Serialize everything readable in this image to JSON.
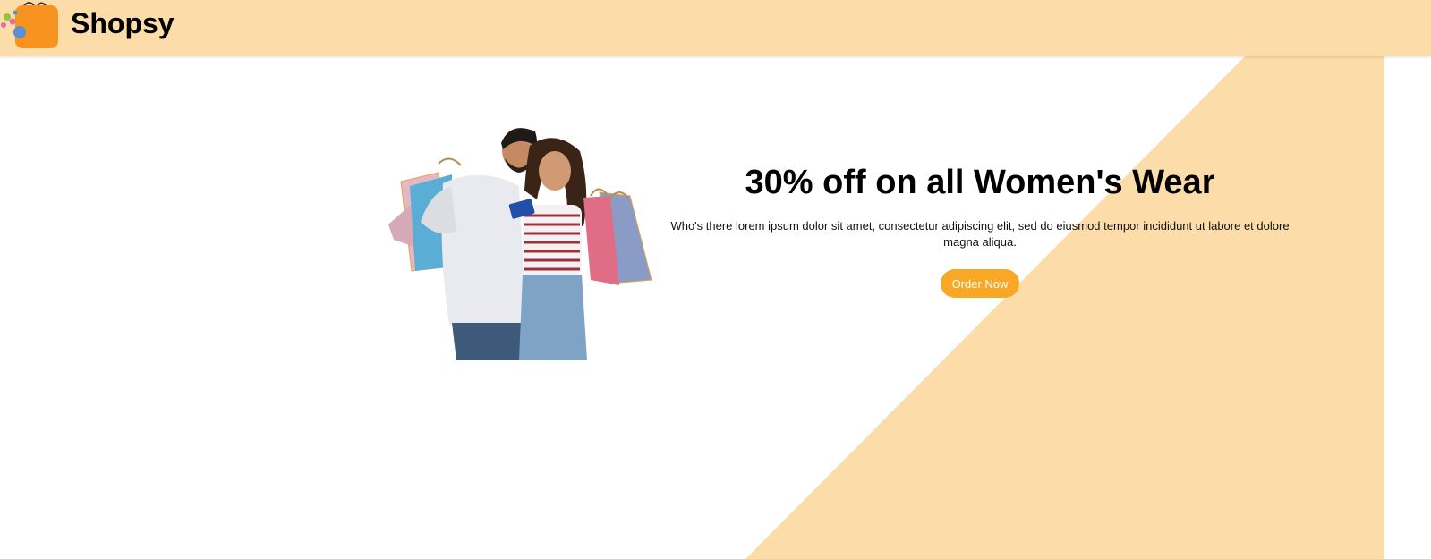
{
  "header": {
    "brand": "Shopsy",
    "logo_icon": "shopping-bag-icon",
    "background_color": "#fcdca8"
  },
  "hero": {
    "headline": "30% off on all Women's Wear",
    "description": "Who's there lorem ipsum dolor sit amet, consectetur adipiscing elit, sed do eiusmod tempor incididunt ut labore et dolore magna aliqua.",
    "cta_label": "Order Now",
    "accent_color": "#f9a825",
    "shape_color": "#fcdca8",
    "image_subject": "couple-with-shopping-bags"
  }
}
